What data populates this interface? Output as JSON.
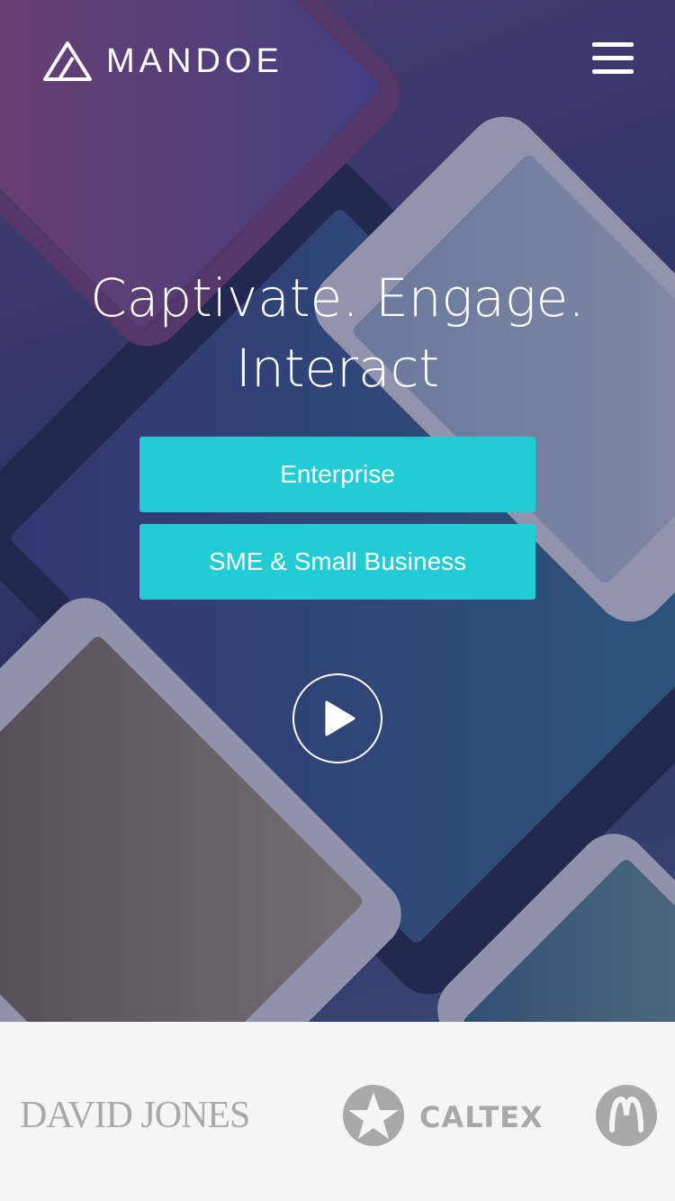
{
  "header": {
    "brand_name": "MANDOE",
    "logo_icon": "mandoe-triangle-logo",
    "menu_icon": "hamburger-menu-icon"
  },
  "hero": {
    "headline_line1": "Captivate. Engage.",
    "headline_line2": "Interact",
    "buttons": {
      "enterprise": "Enterprise",
      "sme": "SME & Small Business"
    },
    "play_icon": "play-icon",
    "accent_color": "#22ccd4"
  },
  "clients": {
    "david_jones": "DAVID JONES",
    "caltex": "CALTEX",
    "caltex_icon": "caltex-star-icon",
    "mcdonalds_icon": "mcdonalds-logo-icon",
    "logo_color": "#a9a9a9"
  }
}
